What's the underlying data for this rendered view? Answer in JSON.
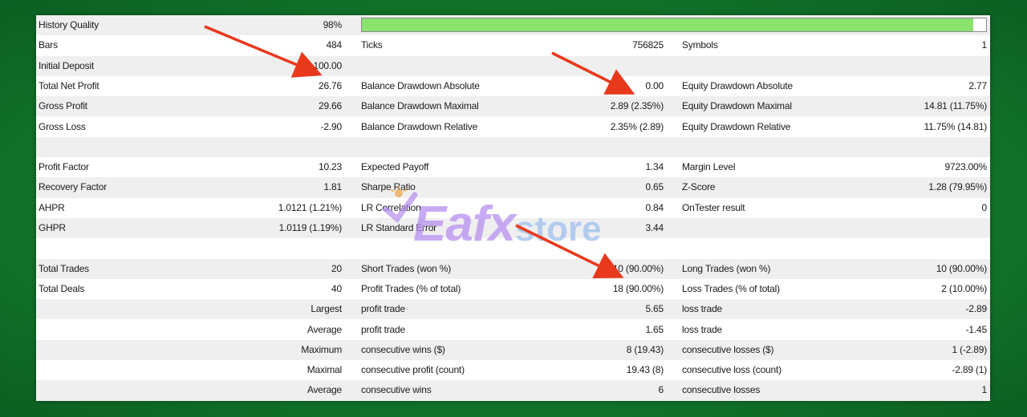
{
  "watermark": {
    "brand_main": "Eafx",
    "brand_sub": "store"
  },
  "history_quality": {
    "label": "History Quality",
    "value": "98%",
    "fill_fraction": 0.98
  },
  "rows": [
    {
      "c1": "Bars",
      "v1": "484",
      "c2": "Ticks",
      "v2": "756825",
      "c3": "Symbols",
      "v3": "1"
    },
    {
      "c1": "Initial Deposit",
      "v1": "100.00",
      "c2": "",
      "v2": "",
      "c3": "",
      "v3": ""
    },
    {
      "c1": "Total Net Profit",
      "v1": "26.76",
      "c2": "Balance Drawdown Absolute",
      "v2": "0.00",
      "c3": "Equity Drawdown Absolute",
      "v3": "2.77"
    },
    {
      "c1": "Gross Profit",
      "v1": "29.66",
      "c2": "Balance Drawdown Maximal",
      "v2": "2.89 (2.35%)",
      "c3": "Equity Drawdown Maximal",
      "v3": "14.81 (11.75%)"
    },
    {
      "c1": "Gross Loss",
      "v1": "-2.90",
      "c2": "Balance Drawdown Relative",
      "v2": "2.35% (2.89)",
      "c3": "Equity Drawdown Relative",
      "v3": "11.75% (14.81)"
    },
    {
      "c1": "",
      "v1": "",
      "c2": "",
      "v2": "",
      "c3": "",
      "v3": ""
    },
    {
      "c1": "Profit Factor",
      "v1": "10.23",
      "c2": "Expected Payoff",
      "v2": "1.34",
      "c3": "Margin Level",
      "v3": "9723.00%"
    },
    {
      "c1": "Recovery Factor",
      "v1": "1.81",
      "c2": "Sharpe Ratio",
      "v2": "0.65",
      "c3": "Z-Score",
      "v3": "1.28 (79.95%)"
    },
    {
      "c1": "AHPR",
      "v1": "1.0121 (1.21%)",
      "c2": "LR Correlation",
      "v2": "0.84",
      "c3": "OnTester result",
      "v3": "0"
    },
    {
      "c1": "GHPR",
      "v1": "1.0119 (1.19%)",
      "c2": "LR Standard Error",
      "v2": "3.44",
      "c3": "",
      "v3": ""
    },
    {
      "c1": "",
      "v1": "",
      "c2": "",
      "v2": "",
      "c3": "",
      "v3": ""
    },
    {
      "c1": "Total Trades",
      "v1": "20",
      "c2": "Short Trades (won %)",
      "v2": "10 (90.00%)",
      "c3": "Long Trades (won %)",
      "v3": "10 (90.00%)"
    },
    {
      "c1": "Total Deals",
      "v1": "40",
      "c2": "Profit Trades (% of total)",
      "v2": "18 (90.00%)",
      "c3": "Loss Trades (% of total)",
      "v3": "2 (10.00%)"
    },
    {
      "c1r": "Largest",
      "c2": "profit trade",
      "v2": "5.65",
      "c3": "loss trade",
      "v3": "-2.89"
    },
    {
      "c1r": "Average",
      "c2": "profit trade",
      "v2": "1.65",
      "c3": "loss trade",
      "v3": "-1.45"
    },
    {
      "c1r": "Maximum",
      "c2": "consecutive wins ($)",
      "v2": "8 (19.43)",
      "c3": "consecutive losses ($)",
      "v3": "1 (-2.89)"
    },
    {
      "c1r": "Maximal",
      "c2": "consecutive profit (count)",
      "v2": "19.43 (8)",
      "c3": "consecutive loss (count)",
      "v3": "-2.89 (1)"
    },
    {
      "c1r": "Average",
      "c2": "consecutive wins",
      "v2": "6",
      "c3": "consecutive losses",
      "v3": "1"
    }
  ],
  "colors": {
    "background": "#127a2c",
    "bar_fill": "#8ae26f",
    "arrow": "#e8391d",
    "row_alt": "#efefef"
  }
}
